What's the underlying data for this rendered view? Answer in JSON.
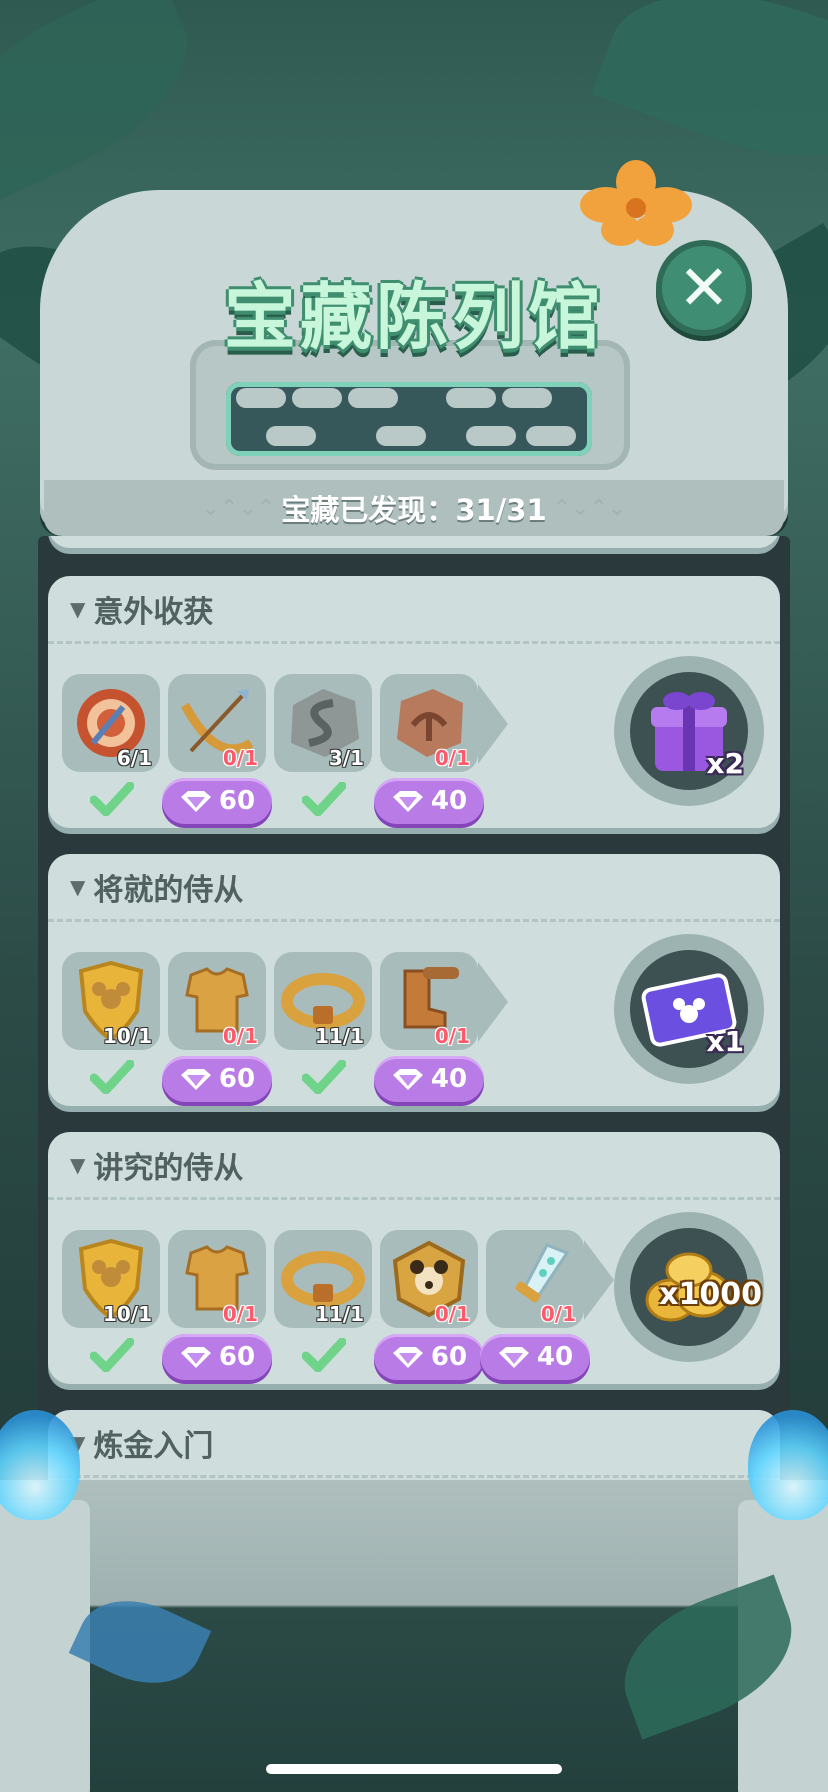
{
  "header": {
    "title": "宝藏陈列馆",
    "found_text": "宝藏已发现：31/31"
  },
  "colors": {
    "title_fill": "#c7f6da",
    "title_outline": "#3f8e6f",
    "price_button": "#b97be6",
    "zero_count": "#ff5a6b",
    "card_bg": "#cfdedd"
  },
  "collections": [
    {
      "name": "意外收获",
      "items": [
        {
          "icon": "dart-target-icon",
          "count": "6/1",
          "status": "done"
        },
        {
          "icon": "bow-arrow-icon",
          "count": "0/1",
          "status": "buy",
          "price": "60"
        },
        {
          "icon": "snake-stone-icon",
          "count": "3/1",
          "status": "done"
        },
        {
          "icon": "scorpion-stone-icon",
          "count": "0/1",
          "status": "buy",
          "price": "40"
        }
      ],
      "reward": {
        "icon": "gift-box-icon",
        "qty": "x2"
      }
    },
    {
      "name": "将就的侍从",
      "items": [
        {
          "icon": "mickey-shield-icon",
          "count": "10/1",
          "status": "done"
        },
        {
          "icon": "armor-icon",
          "count": "0/1",
          "status": "buy",
          "price": "60"
        },
        {
          "icon": "belt-icon",
          "count": "11/1",
          "status": "done"
        },
        {
          "icon": "boots-icon",
          "count": "0/1",
          "status": "buy",
          "price": "40"
        }
      ],
      "reward": {
        "icon": "magic-ticket-icon",
        "qty": "x1"
      }
    },
    {
      "name": "讲究的侍从",
      "items": [
        {
          "icon": "mickey-shield-icon",
          "count": "10/1",
          "status": "done"
        },
        {
          "icon": "armor-icon",
          "count": "0/1",
          "status": "buy",
          "price": "60"
        },
        {
          "icon": "belt-icon",
          "count": "11/1",
          "status": "done"
        },
        {
          "icon": "bear-shield-icon",
          "count": "0/1",
          "status": "buy",
          "price": "60"
        },
        {
          "icon": "crystal-sword-icon",
          "count": "0/1",
          "status": "buy",
          "price": "40"
        }
      ],
      "reward": {
        "icon": "gold-coins-icon",
        "qty": "x1000"
      }
    },
    {
      "name": "炼金入门"
    }
  ]
}
